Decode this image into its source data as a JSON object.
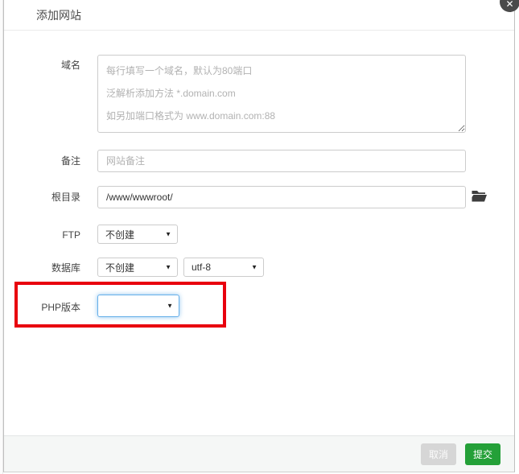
{
  "modal": {
    "title": "添加网站"
  },
  "icons": {
    "close": "✕",
    "caret_down": "▼"
  },
  "form": {
    "domain": {
      "label": "域名",
      "placeholder": "每行填写一个域名，默认为80端口\n泛解析添加方法 *.domain.com\n如另加端口格式为 www.domain.com:88"
    },
    "remark": {
      "label": "备注",
      "placeholder": "网站备注"
    },
    "root": {
      "label": "根目录",
      "value": "/www/wwwroot/"
    },
    "ftp": {
      "label": "FTP",
      "selected": "不创建"
    },
    "database": {
      "label": "数据库",
      "selected": "不创建",
      "charset_selected": "utf-8"
    },
    "php": {
      "label": "PHP版本",
      "selected": ""
    }
  },
  "footer": {
    "cancel_label": "取消",
    "submit_label": "提交"
  },
  "annotation": {
    "description": "red highlight box around PHP version row",
    "color": "#e8000e"
  },
  "colors": {
    "submit_green": "#24a038",
    "cancel_gray": "#d6d6d6",
    "focus_blue": "#66afe9",
    "annotation_red": "#e8000e"
  }
}
